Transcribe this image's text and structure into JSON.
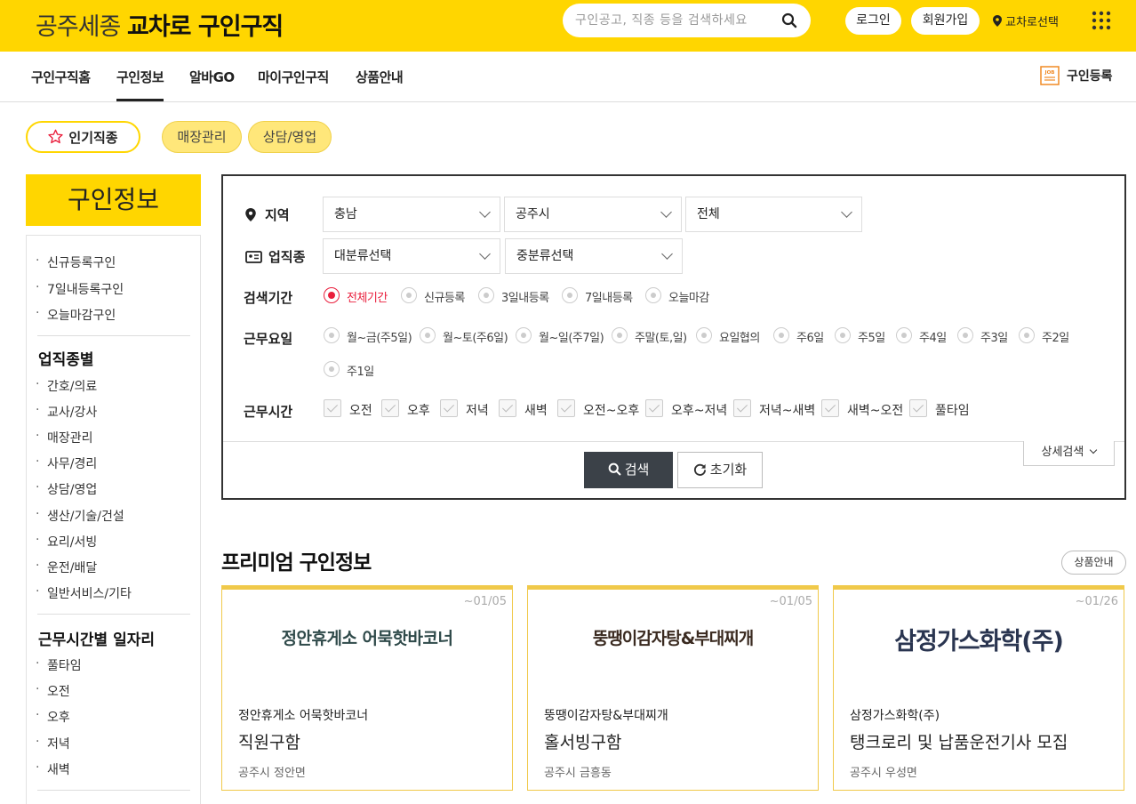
{
  "header": {
    "logo_prefix": "공주세종 ",
    "logo_brand": "교차로",
    "logo_suffix": " 구인구직",
    "search_placeholder": "구인공고, 직종 등을 검색하세요",
    "login": "로그인",
    "signup": "회원가입",
    "region_select": "교차로선택"
  },
  "nav": {
    "tabs": [
      "구인구직홈",
      "구인정보",
      "알바GO",
      "마이구인구직",
      "상품안내"
    ],
    "active_index": 1,
    "post_job": "구인등록",
    "post_job_icon_text": "JOB"
  },
  "chips": {
    "popular": "인기직종",
    "items": [
      "매장관리",
      "상담/영업"
    ]
  },
  "sidebar": {
    "title": "구인정보",
    "quick": [
      "신규등록구인",
      "7일내등록구인",
      "오늘마감구인"
    ],
    "section1_title": "업직종별",
    "section1_items": [
      "간호/의료",
      "교사/강사",
      "매장관리",
      "사무/경리",
      "상담/영업",
      "생산/기술/건설",
      "요리/서빙",
      "운전/배달",
      "일반서비스/기타"
    ],
    "section2_title": "근무시간별 일자리",
    "section2_items": [
      "풀타임",
      "오전",
      "오후",
      "저녁",
      "새벽"
    ]
  },
  "search": {
    "region_label": "지역",
    "region_values": [
      "충남",
      "공주시",
      "전체"
    ],
    "job_label": "업직종",
    "job_values": [
      "대분류선택",
      "중분류선택"
    ],
    "period_label": "검색기간",
    "period_options": [
      "전체기간",
      "신규등록",
      "3일내등록",
      "7일내등록",
      "오늘마감"
    ],
    "period_selected": 0,
    "days_label": "근무요일",
    "days_options": [
      "월~금(주5일)",
      "월~토(주6일)",
      "월~일(주7일)",
      "주말(토,일)",
      "요일협의",
      "주6일",
      "주5일",
      "주4일",
      "주3일",
      "주2일",
      "주1일"
    ],
    "time_label": "근무시간",
    "time_options": [
      "오전",
      "오후",
      "저녁",
      "새벽",
      "오전~오후",
      "오후~저녁",
      "저녁~새벽",
      "새벽~오전",
      "풀타임"
    ],
    "search_button": "검색",
    "reset_button": "초기화",
    "detail_button": "상세검색"
  },
  "premium": {
    "title": "프리미엄 구인정보",
    "guide_button": "상품안내",
    "cards": [
      {
        "date": "~01/05",
        "logo": "정안휴게소 어묵핫바코너",
        "company": "정안휴게소 어묵핫바코너",
        "title": "직원구함",
        "location": "공주시 정안면"
      },
      {
        "date": "~01/05",
        "logo": "뚱땡이감자탕&부대찌개",
        "company": "뚱땡이감자탕&부대찌개",
        "title": "홀서빙구함",
        "location": "공주시 금흥동"
      },
      {
        "date": "~01/26",
        "logo": "삼정가스화학(주)",
        "company": "삼정가스화학(주)",
        "title": "탱크로리 및 납품운전기사 모집",
        "location": "공주시 우성면"
      }
    ]
  },
  "colors": {
    "brand_yellow": "#ffd600",
    "accent_red": "#e91e3c",
    "dark_button": "#3b4148",
    "card_border": "#f0c94a"
  }
}
